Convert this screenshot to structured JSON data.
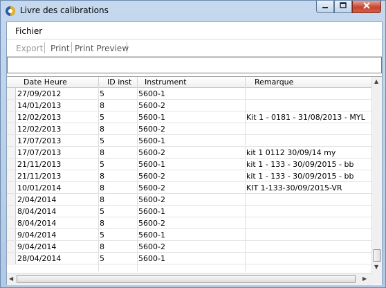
{
  "window": {
    "title": "Livre des calibrations"
  },
  "menu": {
    "items": [
      "Fichier"
    ]
  },
  "toolbar": {
    "export": "Export",
    "print": "Print",
    "print_preview": "Print Preview"
  },
  "filter": {
    "value": ""
  },
  "grid": {
    "columns": [
      "Date Heure",
      "ID inst",
      "Instrument",
      "Remarque"
    ],
    "rows": [
      [
        "27/09/2012",
        "5",
        "5600-1",
        ""
      ],
      [
        "14/01/2013",
        "8",
        "5600-2",
        ""
      ],
      [
        "12/02/2013",
        "5",
        "5600-1",
        "Kit 1 - 0181 - 31/08/2013 - MYL"
      ],
      [
        "12/02/2013",
        "8",
        "5600-2",
        ""
      ],
      [
        "17/07/2013",
        "5",
        "5600-1",
        ""
      ],
      [
        "17/07/2013",
        "8",
        "5600-2",
        "kit 1 0112 30/09/14 my"
      ],
      [
        "21/11/2013",
        "5",
        "5600-1",
        "kit 1 - 133 - 30/09/2015 - bb"
      ],
      [
        "21/11/2013",
        "8",
        "5600-2",
        "kit 1 - 133 - 30/09/2015 - bb"
      ],
      [
        "10/01/2014",
        "8",
        "5600-2",
        "KIT 1-133-30/09/2015-VR"
      ],
      [
        "2/04/2014",
        "8",
        "5600-2",
        ""
      ],
      [
        "8/04/2014",
        "5",
        "5600-1",
        ""
      ],
      [
        "8/04/2014",
        "8",
        "5600-2",
        ""
      ],
      [
        "9/04/2014",
        "5",
        "5600-1",
        ""
      ],
      [
        "9/04/2014",
        "8",
        "5600-2",
        ""
      ],
      [
        "28/04/2014",
        "5",
        "5600-1",
        ""
      ]
    ]
  },
  "icons": {
    "app": "app-icon",
    "minimize": "minimize-icon",
    "maximize": "maximize-icon",
    "close": "close-icon"
  }
}
